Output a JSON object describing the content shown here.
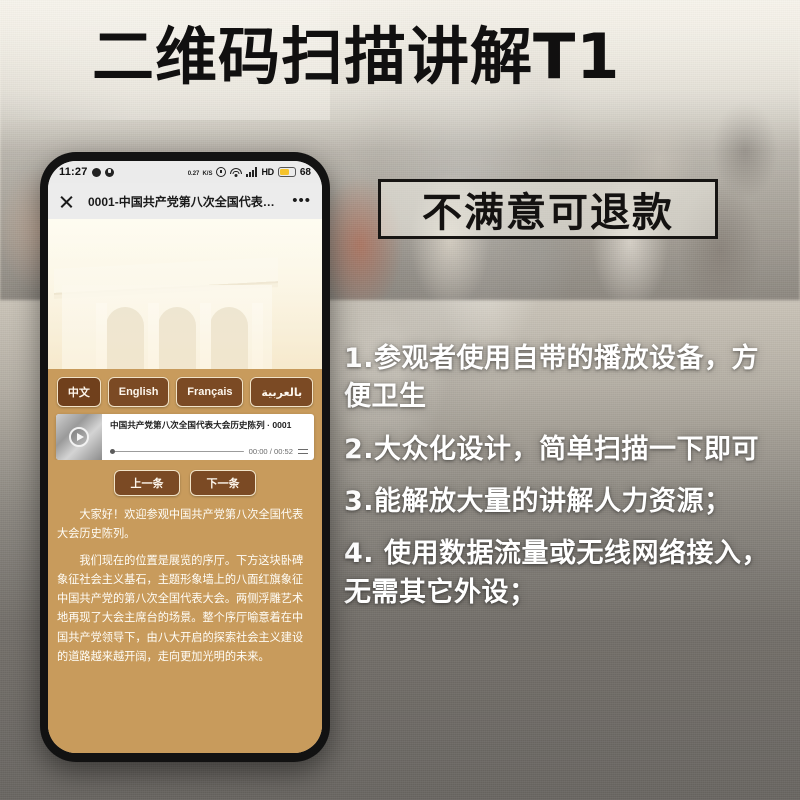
{
  "poster": {
    "headline": "二维码扫描讲解T1",
    "slogan": "不满意可退款",
    "features": [
      "1.参观者使用自带的播放设备，方便卫生",
      "2.大众化设计，简单扫描一下即可",
      "3.能解放大量的讲解人力资源；",
      "4. 使用数据流量或无线网络接入，无需其它外设；"
    ],
    "accent_color": "#c89b5c",
    "button_color": "#7b4a24",
    "headline_color": "#111010"
  },
  "phone": {
    "status_bar": {
      "clock": "11:27",
      "net_rate_top": "0.27",
      "net_rate_bottom": "K/S",
      "hd_label": "HD",
      "battery_percent": "68",
      "icons": [
        "face-icon",
        "moon-icon",
        "network-rate-icon",
        "alarm-icon",
        "wifi-icon",
        "signal-bars-icon",
        "hd-icon",
        "battery-icon"
      ]
    },
    "wechat_nav": {
      "close_label": "×",
      "title": "0001-中国共产党第八次全国代表大...",
      "more_label": "•••"
    },
    "languages": [
      {
        "label": "中文",
        "active": true
      },
      {
        "label": "English",
        "active": false
      },
      {
        "label": "Français",
        "active": false
      },
      {
        "label": "بالعربية",
        "active": false
      }
    ],
    "player": {
      "title": "中国共产党第八次全国代表大会历史陈列 · 0001",
      "time": "00:00 / 00:52",
      "loop_icon": "loop-icon",
      "play_icon": "play-icon"
    },
    "nav_buttons": [
      {
        "label": "上一条"
      },
      {
        "label": "下一条"
      }
    ],
    "article": {
      "paragraph_1": "大家好！欢迎参观中国共产党第八次全国代表大会历史陈列。",
      "paragraph_2": "我们现在的位置是展览的序厅。下方这块卧碑象征社会主义基石，主题形象墙上的八面红旗象征中国共产党的第八次全国代表大会。两侧浮雕艺术地再现了大会主席台的场景。整个序厅喻意着在中国共产党领导下，由八大开启的探索社会主义建设的道路越来越开阔，走向更加光明的未来。"
    }
  }
}
